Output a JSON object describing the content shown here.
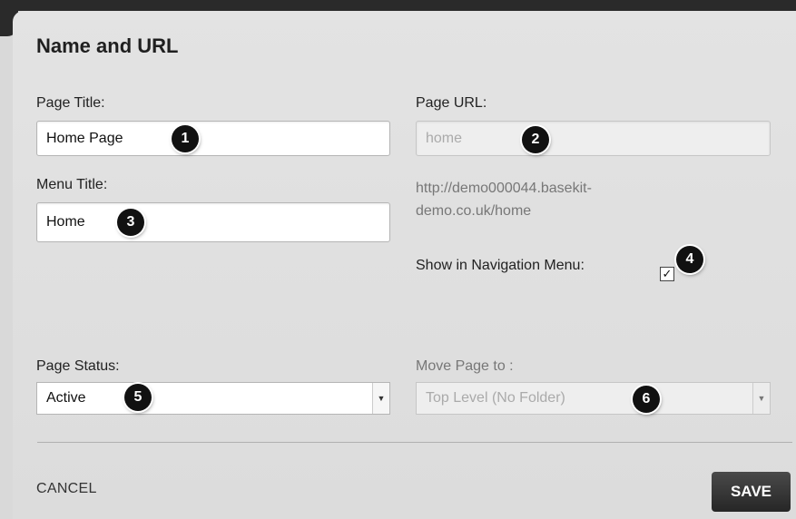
{
  "dialog": {
    "title": "Name and URL"
  },
  "page_title": {
    "label": "Page Title:",
    "value": "Home Page"
  },
  "page_url": {
    "label": "Page URL:",
    "value": "home",
    "full_url": "http://demo000044.basekit-demo.co.uk/home"
  },
  "menu_title": {
    "label": "Menu Title:",
    "value": "Home"
  },
  "show_in_nav": {
    "label": "Show in Navigation Menu:",
    "checked": true,
    "check_glyph": "✓"
  },
  "page_status": {
    "label": "Page Status:",
    "value": "Active"
  },
  "move_page": {
    "label": "Move Page to :",
    "value": "Top Level (No Folder)"
  },
  "actions": {
    "cancel": "CANCEL",
    "save": "SAVE"
  },
  "badges": [
    "1",
    "2",
    "3",
    "4",
    "5",
    "6"
  ],
  "icons": {
    "dropdown": "chevron-down-icon",
    "checkbox": "check-icon"
  },
  "colors": {
    "badge": "#111111",
    "save_button": "#333333",
    "background": "#dedede"
  }
}
